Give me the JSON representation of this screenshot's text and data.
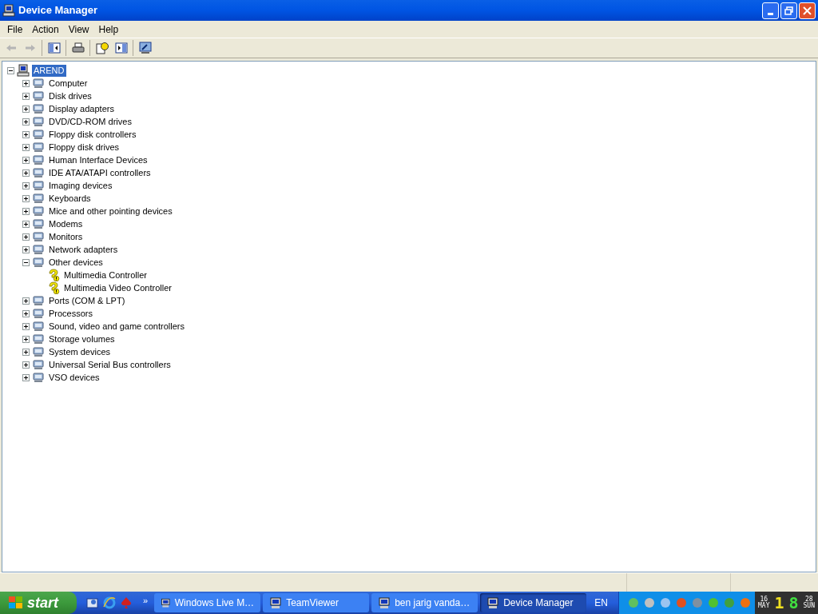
{
  "window": {
    "title": "Device Manager"
  },
  "menu": [
    {
      "label": "File"
    },
    {
      "label": "Action"
    },
    {
      "label": "View"
    },
    {
      "label": "Help"
    }
  ],
  "tree": {
    "label": "AREND",
    "selected": true,
    "expanded": true,
    "children": [
      {
        "label": "Computer",
        "expanded": false,
        "selected": false
      },
      {
        "label": "Disk drives",
        "expanded": false,
        "selected": false
      },
      {
        "label": "Display adapters",
        "expanded": false,
        "selected": false
      },
      {
        "label": "DVD/CD-ROM drives",
        "expanded": false,
        "selected": false
      },
      {
        "label": "Floppy disk controllers",
        "expanded": false,
        "selected": false
      },
      {
        "label": "Floppy disk drives",
        "expanded": false,
        "selected": false
      },
      {
        "label": "Human Interface Devices",
        "expanded": false,
        "selected": false
      },
      {
        "label": "IDE ATA/ATAPI controllers",
        "expanded": false,
        "selected": false
      },
      {
        "label": "Imaging devices",
        "expanded": false,
        "selected": false
      },
      {
        "label": "Keyboards",
        "expanded": false,
        "selected": false
      },
      {
        "label": "Mice and other pointing devices",
        "expanded": false,
        "selected": false
      },
      {
        "label": "Modems",
        "expanded": false,
        "selected": false
      },
      {
        "label": "Monitors",
        "expanded": false,
        "selected": false
      },
      {
        "label": "Network adapters",
        "expanded": false,
        "selected": false
      },
      {
        "label": "Other devices",
        "expanded": true,
        "selected": false,
        "children": [
          {
            "label": "Multimedia Controller",
            "warning": true,
            "selected": false
          },
          {
            "label": "Multimedia Video Controller",
            "warning": true,
            "selected": false
          }
        ]
      },
      {
        "label": "Ports (COM & LPT)",
        "expanded": false,
        "selected": false
      },
      {
        "label": "Processors",
        "expanded": false,
        "selected": false
      },
      {
        "label": "Sound, video and game controllers",
        "expanded": false,
        "selected": false
      },
      {
        "label": "Storage volumes",
        "expanded": false,
        "selected": false
      },
      {
        "label": "System devices",
        "expanded": false,
        "selected": false
      },
      {
        "label": "Universal Serial Bus controllers",
        "expanded": false,
        "selected": false
      },
      {
        "label": "VSO devices",
        "expanded": false,
        "selected": false
      }
    ]
  },
  "taskbar": {
    "start": "start",
    "chevron": "»",
    "tasks": [
      {
        "label": "Windows Live M…",
        "selected": false
      },
      {
        "label": "TeamViewer",
        "selected": false
      },
      {
        "label": "ben jarig vanda…",
        "selected": false
      },
      {
        "label": "Device Manager",
        "selected": true
      }
    ],
    "language": "EN",
    "clock": {
      "date_day": "16",
      "date_month": "MAY",
      "hour": "1",
      "minute": "8",
      "seconds": "28",
      "weekday": "SUN"
    }
  }
}
